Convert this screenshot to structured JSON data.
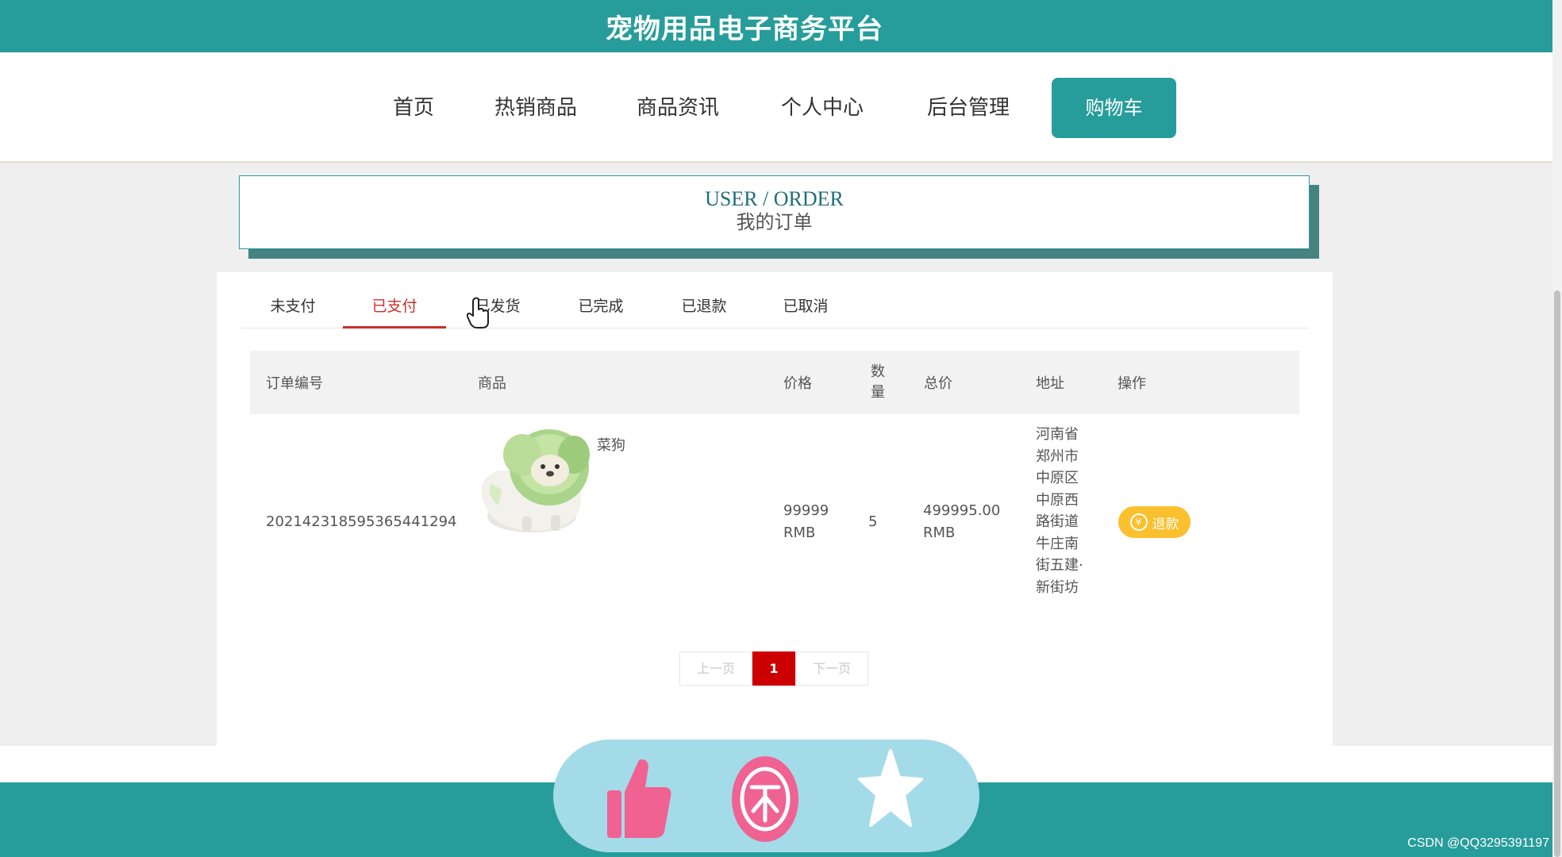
{
  "site": {
    "title": "宠物用品电子商务平台"
  },
  "nav": {
    "items": [
      {
        "label": "首页"
      },
      {
        "label": "热销商品"
      },
      {
        "label": "商品资讯"
      },
      {
        "label": "个人中心"
      },
      {
        "label": "后台管理"
      },
      {
        "label": "购物车",
        "active": true
      }
    ]
  },
  "order_header": {
    "title_en": "USER / ORDER",
    "title_cn": "我的订单"
  },
  "tabs": [
    {
      "label": "未支付"
    },
    {
      "label": "已支付",
      "active": true
    },
    {
      "label": "已发货"
    },
    {
      "label": "已完成"
    },
    {
      "label": "已退款"
    },
    {
      "label": "已取消"
    }
  ],
  "table": {
    "headers": {
      "order_no": "订单编号",
      "product": "商品",
      "price": "价格",
      "qty": "数量",
      "total": "总价",
      "address": "地址",
      "action": "操作"
    },
    "rows": [
      {
        "order_no": "20214231859536544129",
        "order_no_tail": "4",
        "product_name": "菜狗",
        "price": "99999",
        "price_unit": "RMB",
        "qty": "5",
        "total": "499995.00",
        "total_unit": "RMB",
        "address": "河南省郑州市中原区中原西路街道牛庄南街五建·新街坊",
        "action_label": "退款",
        "action_icon": "¥"
      }
    ]
  },
  "pagination": {
    "prev": "上一页",
    "current": "1",
    "next": "下一页"
  },
  "floating_bar": {
    "icons": [
      "thumbs-up-icon",
      "coin-icon",
      "star-icon"
    ]
  },
  "watermark": "CSDN @QQ3295391197",
  "colors": {
    "brand_teal": "#279d9b",
    "active_tab_red": "#c9302c",
    "refund_yellow": "#fbc02d",
    "page_current_red": "#cc0000",
    "float_bar_blue": "#a4dbe8",
    "float_icon_pink": "#f06292"
  }
}
